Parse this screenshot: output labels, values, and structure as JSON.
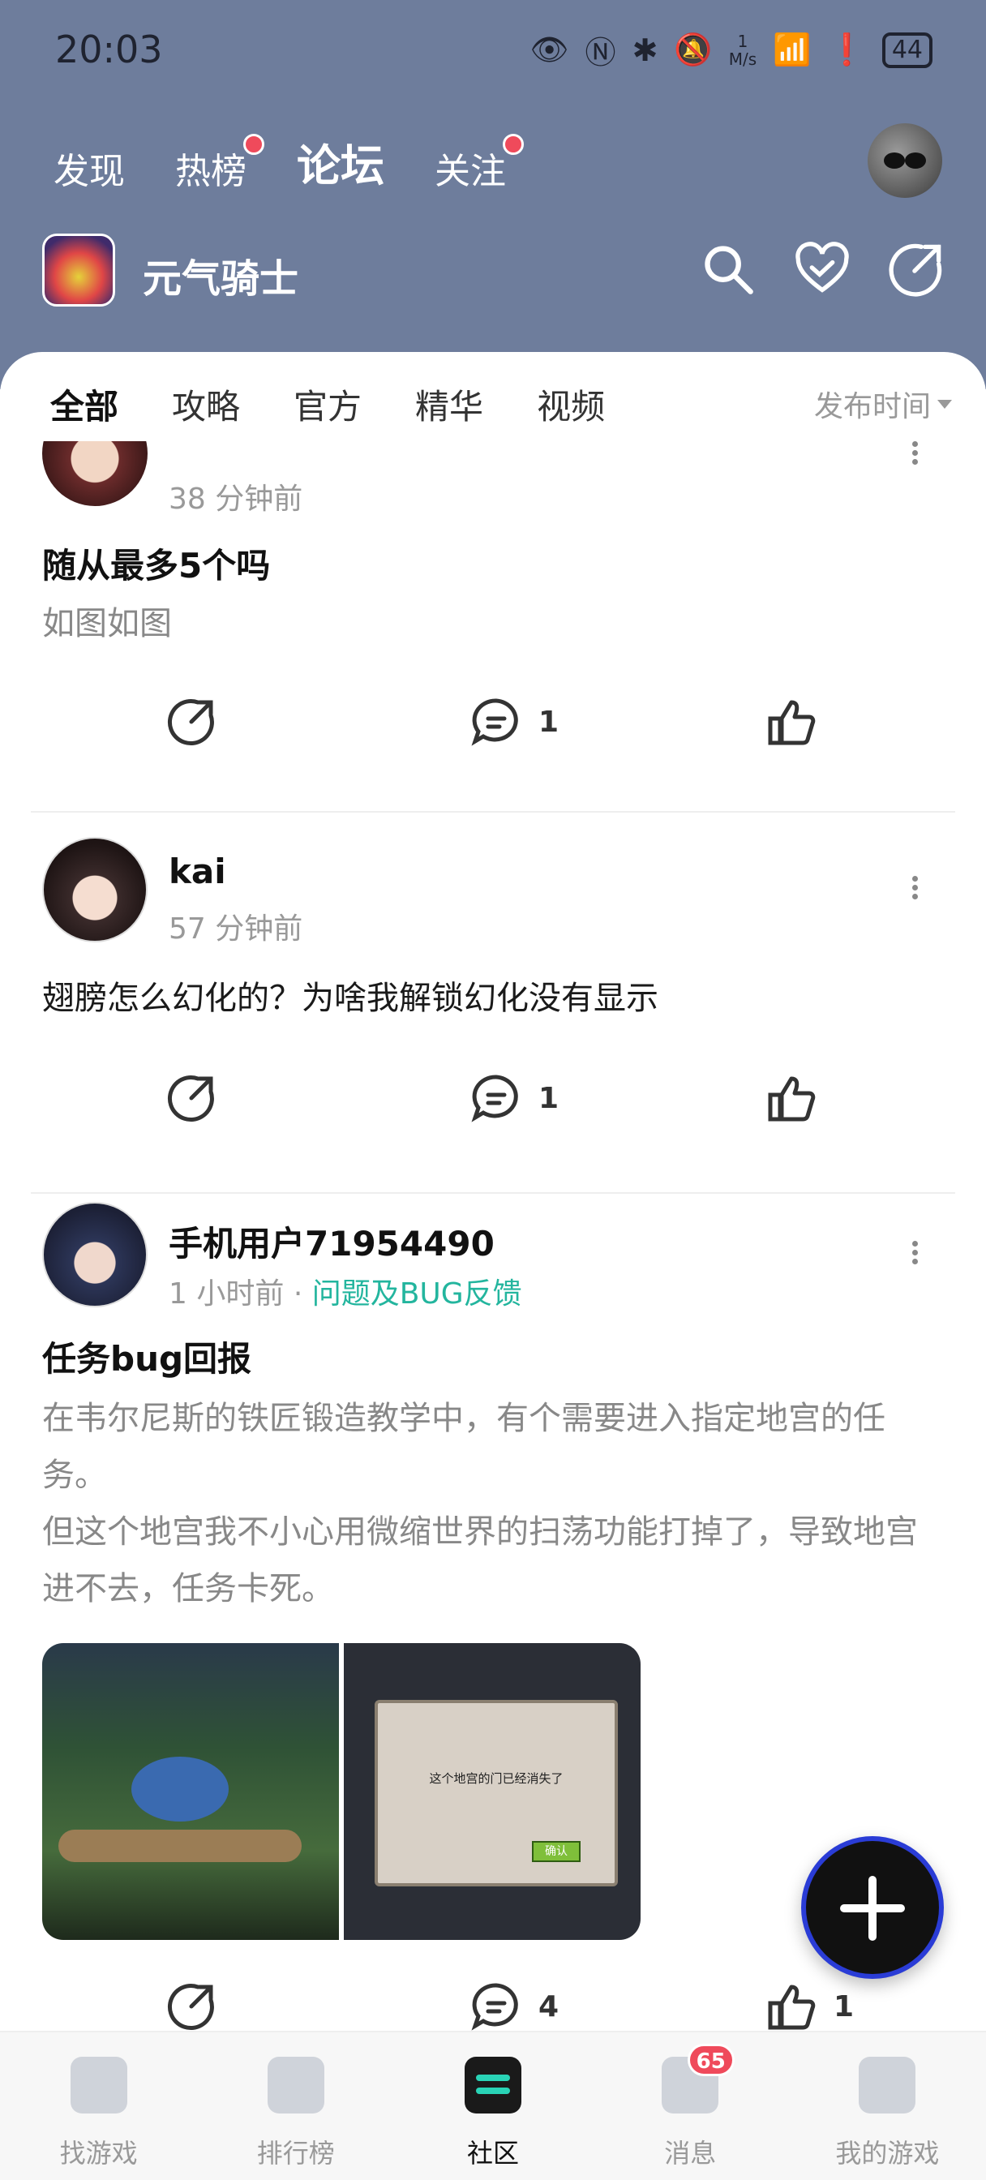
{
  "status_bar": {
    "time": "20:03",
    "net_speed_top": "1",
    "net_speed_unit": "M/s",
    "battery": "44"
  },
  "top_nav": {
    "items": [
      {
        "label": "发现"
      },
      {
        "label": "热榜"
      },
      {
        "label": "论坛"
      },
      {
        "label": "关注"
      }
    ],
    "active": "论坛"
  },
  "game": {
    "title": "元气骑士"
  },
  "tabs": {
    "items": [
      "全部",
      "攻略",
      "官方",
      "精华",
      "视频"
    ],
    "active": "全部",
    "sort_label": "发布时间"
  },
  "posts": [
    {
      "time": "38 分钟前",
      "title": "随从最多5个吗",
      "body": "如图如图",
      "comments": "1",
      "likes": ""
    },
    {
      "author": "kai",
      "time": "57 分钟前",
      "body": "翅膀怎么幻化的？为啥我解锁幻化没有显示",
      "comments": "1",
      "likes": ""
    },
    {
      "author": "手机用户71954490",
      "time": "1 小时前",
      "separator": "·",
      "forum": "问题及BUG反馈",
      "title": "任务bug回报",
      "body_line1": "在韦尔尼斯的铁匠锻造教学中，有个需要进入指定地宫的任务。",
      "body_line2": "但这个地宫我不小心用微缩世界的扫荡功能打掉了，导致地宫进不去，任务卡死。",
      "image2_dialog": "这个地宫的门已经消失了",
      "image2_button": "确认",
      "comments": "4",
      "likes": "1"
    }
  ],
  "bottom_nav": {
    "items": [
      {
        "label": "找游戏"
      },
      {
        "label": "排行榜"
      },
      {
        "label": "社区"
      },
      {
        "label": "消息",
        "badge": "65"
      },
      {
        "label": "我的游戏"
      }
    ],
    "active": "社区"
  },
  "colors": {
    "header_bg": "#6e7d9c",
    "accent": "#29d3b6",
    "badge_red": "#ef4a5b",
    "forum_tag": "#23b59e"
  }
}
